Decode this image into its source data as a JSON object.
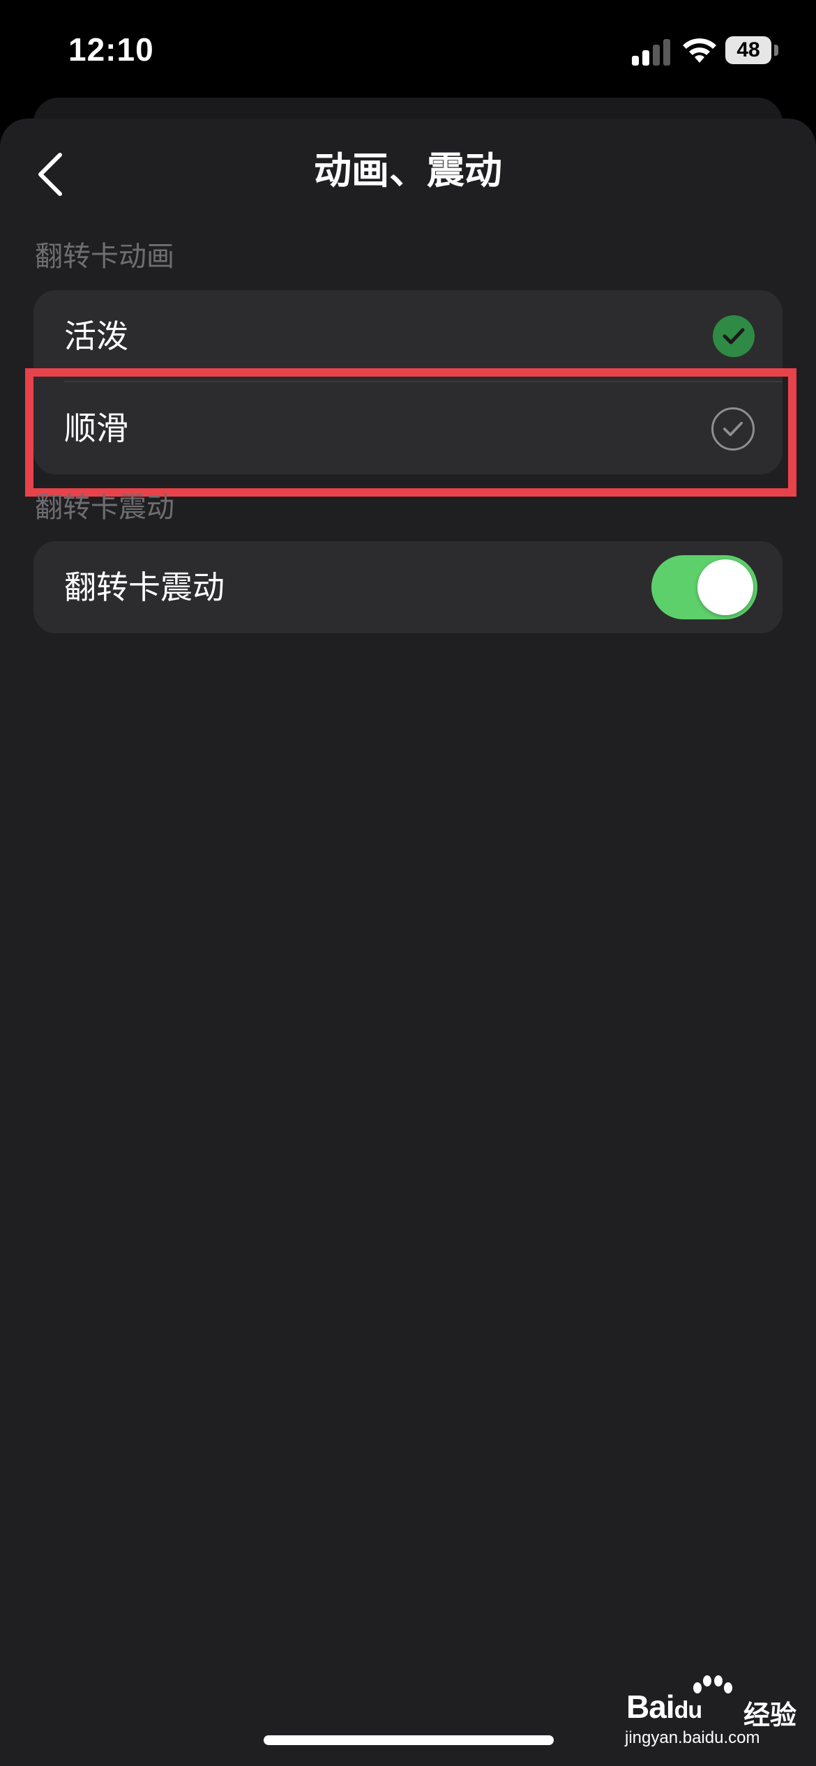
{
  "status_bar": {
    "time": "12:10",
    "battery": "48",
    "icons": [
      "signal-icon",
      "wifi-icon",
      "battery-icon"
    ]
  },
  "nav": {
    "title": "动画、震动",
    "back_icon": "chevron-left-icon"
  },
  "sections": {
    "animation": {
      "header": "翻转卡动画",
      "options": [
        {
          "label": "活泼",
          "selected": true
        },
        {
          "label": "顺滑",
          "selected": false
        }
      ]
    },
    "vibration": {
      "header": "翻转卡震动",
      "toggle_label": "翻转卡震动",
      "toggle_on": true
    }
  },
  "colors": {
    "background": "#000000",
    "sheet": "#1f1f21",
    "group": "#2c2c2e",
    "check_selected": "#2f8a45",
    "toggle_on": "#5ed06b",
    "highlight": "#e8424b"
  },
  "watermark": {
    "brand_bai": "Bai",
    "brand_du": "du",
    "suffix": "经验",
    "url": "jingyan.baidu.com"
  }
}
